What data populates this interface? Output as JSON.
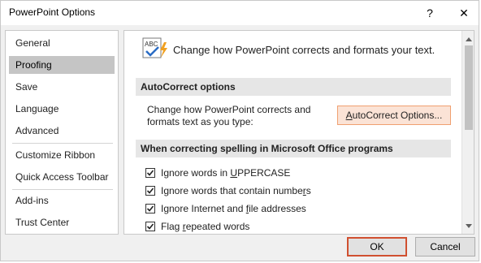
{
  "window": {
    "title": "PowerPoint Options",
    "help_glyph": "?",
    "close_glyph": "✕"
  },
  "sidebar": {
    "items": [
      {
        "label": "General",
        "selected": false
      },
      {
        "label": "Proofing",
        "selected": true
      },
      {
        "label": "Save",
        "selected": false
      },
      {
        "label": "Language",
        "selected": false
      },
      {
        "label": "Advanced",
        "selected": false
      },
      {
        "label": "Customize Ribbon",
        "selected": false
      },
      {
        "label": "Quick Access Toolbar",
        "selected": false
      },
      {
        "label": "Add-ins",
        "selected": false
      },
      {
        "label": "Trust Center",
        "selected": false
      }
    ]
  },
  "content": {
    "icon_text": "ABC",
    "header": "Change how PowerPoint corrects and formats your text.",
    "autocorrect": {
      "section_title": "AutoCorrect options",
      "description_line1": "Change how PowerPoint corrects and",
      "description_line2": "formats text as you type:",
      "button_pre": "",
      "button_accel": "A",
      "button_post": "utoCorrect Options..."
    },
    "spelling": {
      "section_title": "When correcting spelling in Microsoft Office programs",
      "options": [
        {
          "pre": "Ignore words in ",
          "accel": "U",
          "post": "PPERCASE",
          "checked": true
        },
        {
          "pre": "Ignore words that contain numbe",
          "accel": "r",
          "post": "s",
          "checked": true
        },
        {
          "pre": "Ignore Internet and ",
          "accel": "f",
          "post": "ile addresses",
          "checked": true
        },
        {
          "pre": "Flag ",
          "accel": "r",
          "post": "epeated words",
          "checked": true
        }
      ]
    }
  },
  "footer": {
    "ok_label": "OK",
    "cancel_label": "Cancel"
  },
  "colors": {
    "selected_nav": "#c5c5c5",
    "section_bar": "#e6e6e6",
    "autocorrect_button_bg": "#fbe3d6",
    "autocorrect_button_border": "#f0a070",
    "ok_border": "#d05030"
  }
}
